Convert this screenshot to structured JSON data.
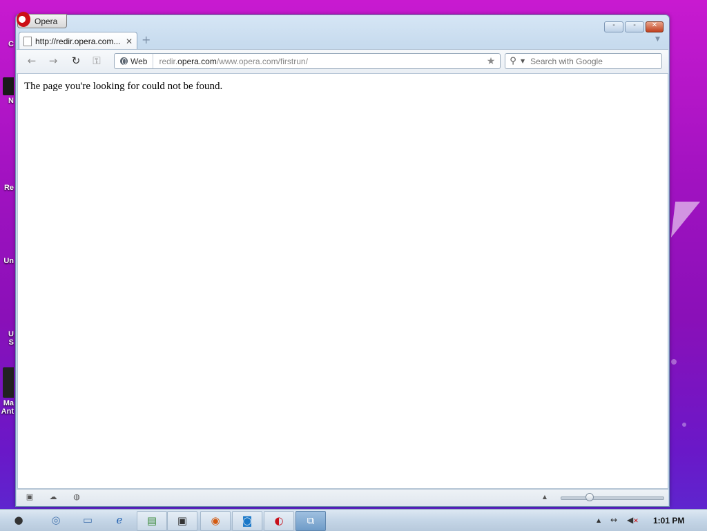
{
  "window": {
    "menu_label": "Opera",
    "controls": {
      "minimize": "-",
      "maximize": "-",
      "close": "✕"
    }
  },
  "tab": {
    "title": "http://redir.opera.com...",
    "close": "✕",
    "new_tab": "+"
  },
  "toolbar": {
    "back": "←",
    "forward": "→",
    "reload": "↻",
    "key": "⚿",
    "address_prefix_label": "Web",
    "url_sub": "redir.",
    "url_domain": "opera.com",
    "url_path": "/www.opera.com/firstrun/",
    "bookmark_star": "★"
  },
  "search": {
    "placeholder": "Search with Google",
    "icon": "🔍"
  },
  "content": {
    "message": "The page you're looking for could not be found."
  },
  "statusbar": {
    "panel_icon": "▣",
    "cloud_icon": "☁",
    "turbo_icon": "◍",
    "scroll_up": "▲"
  },
  "taskbar": {
    "clock": "1:01 PM",
    "items": [
      {
        "name": "apple-icon",
        "glyph": ""
      },
      {
        "name": "globe-icon",
        "glyph": "◎"
      },
      {
        "name": "folder-icon",
        "glyph": "▭"
      },
      {
        "name": "internet-icon",
        "glyph": "ℯ"
      },
      {
        "name": "app-icon",
        "glyph": "▤"
      },
      {
        "name": "monitor-icon",
        "glyph": "▣"
      },
      {
        "name": "firefox-icon",
        "glyph": "◉"
      },
      {
        "name": "chat-icon",
        "glyph": "◙"
      },
      {
        "name": "opera-icon",
        "glyph": "◐"
      },
      {
        "name": "window-switch-icon",
        "glyph": "⧉"
      }
    ],
    "tray": {
      "up_arrow": "▲",
      "network": "↔",
      "volume": "🔇"
    }
  }
}
